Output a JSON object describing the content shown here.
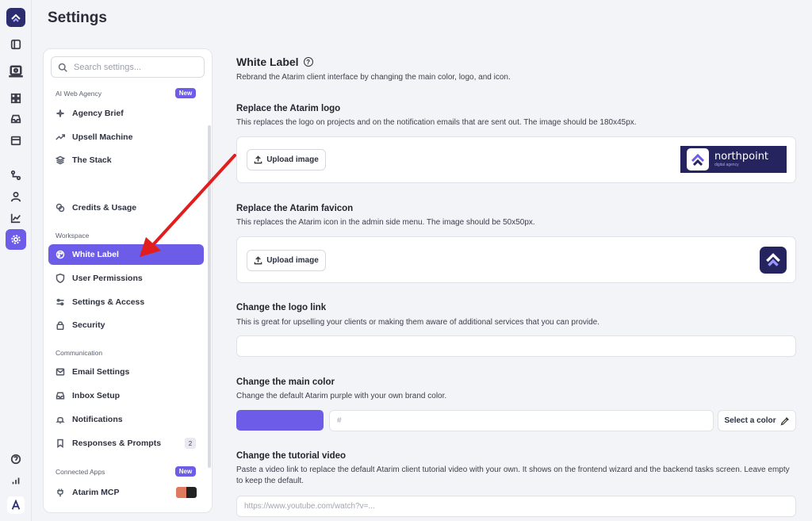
{
  "page": {
    "title": "Settings"
  },
  "sidebar": {
    "search_placeholder": "Search settings...",
    "sections": {
      "ai": "AI Web Agency",
      "workspace": "Workspace",
      "communication": "Communication",
      "connected": "Connected Apps"
    },
    "badges": {
      "new": "New"
    },
    "items": [
      {
        "label": "Agency Brief",
        "icon": "sparkles-icon"
      },
      {
        "label": "Upsell Machine",
        "icon": "trend-up-icon"
      },
      {
        "label": "The Stack",
        "icon": "layers-icon"
      },
      {
        "label": "Credits & Usage",
        "icon": "coins-icon"
      },
      {
        "label": "White Label",
        "icon": "palette-icon",
        "active": true
      },
      {
        "label": "User Permissions",
        "icon": "shield-icon"
      },
      {
        "label": "Settings & Access",
        "icon": "sliders-icon"
      },
      {
        "label": "Security",
        "icon": "lock-icon"
      },
      {
        "label": "Email Settings",
        "icon": "mail-icon"
      },
      {
        "label": "Inbox Setup",
        "icon": "inbox-icon"
      },
      {
        "label": "Notifications",
        "icon": "bell-icon"
      },
      {
        "label": "Responses & Prompts",
        "icon": "bookmark-icon",
        "count": "2"
      },
      {
        "label": "Atarim MCP",
        "icon": "plug-icon"
      }
    ]
  },
  "main": {
    "title": "White Label",
    "subtitle": "Rebrand the Atarim client interface by changing the main color, logo, and icon.",
    "logo": {
      "heading": "Replace the Atarim logo",
      "desc": "This replaces the logo on projects and on the notification emails that are sent out. The image should be 180x45px.",
      "upload_label": "Upload image",
      "preview_name": "northpoint",
      "preview_tagline": "digital agency"
    },
    "favicon": {
      "heading": "Replace the Atarim favicon",
      "desc": "This replaces the Atarim icon in the admin side menu. The image should be 50x50px.",
      "upload_label": "Upload image"
    },
    "logo_link": {
      "heading": "Change the logo link",
      "desc": "This is great for upselling your clients or making them aware of additional services that you can provide.",
      "value": ""
    },
    "main_color": {
      "heading": "Change the main color",
      "desc": "Change the default Atarim purple with your own brand color.",
      "swatch": "#6c5ce7",
      "hex_placeholder": "#",
      "select_label": "Select a color"
    },
    "tutorial": {
      "heading": "Change the tutorial video",
      "desc": "Paste a video link to replace the default Atarim client tutorial video with your own. It shows on the frontend wizard and the backend tasks screen. Leave empty to keep the default.",
      "placeholder": "https://www.youtube.com/watch?v=..."
    }
  },
  "colors": {
    "accent": "#6c5ce7",
    "brand_dark": "#26245e",
    "annotation_arrow": "#e11d1d"
  }
}
